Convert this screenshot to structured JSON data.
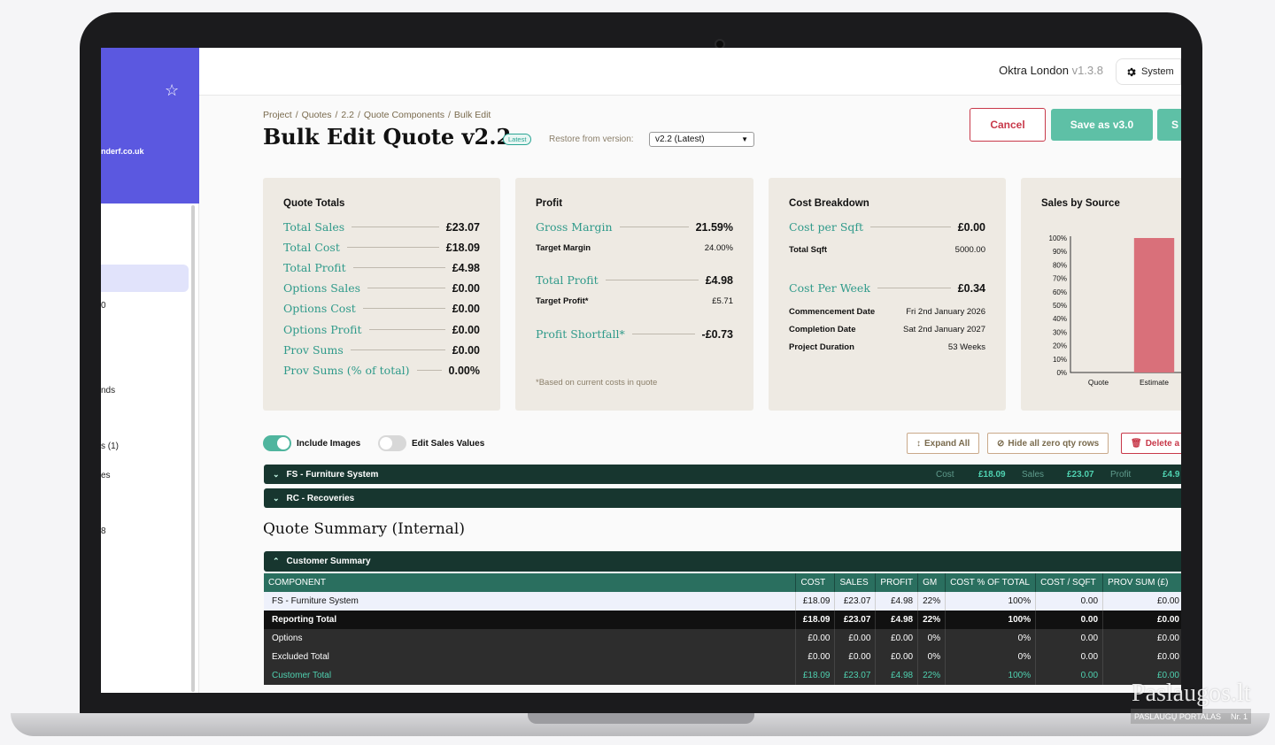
{
  "sidebar": {
    "email": "nderf.co.uk",
    "items": [
      "0",
      "nds",
      "s (1)",
      "es",
      "8"
    ]
  },
  "topbar": {
    "org": "Oktra London",
    "version": "v1.3.8",
    "system_label": "System"
  },
  "breadcrumb": [
    "Project",
    "/",
    "Quotes",
    "/",
    "2.2",
    "/",
    "Quote Components",
    "/",
    "Bulk Edit"
  ],
  "page": {
    "title": "Bulk Edit Quote v2.2",
    "badge": "Latest",
    "restore_label": "Restore from version:",
    "restore_value": "v2.2 (Latest)",
    "cancel": "Cancel",
    "save": "Save as v3.0",
    "save2": "S"
  },
  "quote_totals": {
    "title": "Quote Totals",
    "rows": [
      {
        "k": "Total Sales",
        "v": "£23.07"
      },
      {
        "k": "Total Cost",
        "v": "£18.09"
      },
      {
        "k": "Total Profit",
        "v": "£4.98"
      },
      {
        "k": "Options Sales",
        "v": "£0.00"
      },
      {
        "k": "Options Cost",
        "v": "£0.00"
      },
      {
        "k": "Options Profit",
        "v": "£0.00"
      },
      {
        "k": "Prov Sums",
        "v": "£0.00"
      },
      {
        "k": "Prov Sums (% of total)",
        "v": "0.00%"
      }
    ]
  },
  "profit": {
    "title": "Profit",
    "gross_margin_k": "Gross Margin",
    "gross_margin_v": "21.59%",
    "target_margin_k": "Target Margin",
    "target_margin_v": "24.00%",
    "total_profit_k": "Total Profit",
    "total_profit_v": "£4.98",
    "target_profit_k": "Target Profit*",
    "target_profit_v": "£5.71",
    "shortfall_k": "Profit Shortfall*",
    "shortfall_v": "-£0.73",
    "note": "*Based on current costs in quote"
  },
  "cost_breakdown": {
    "title": "Cost Breakdown",
    "cost_sqft_k": "Cost per Sqft",
    "cost_sqft_v": "£0.00",
    "total_sqft_k": "Total Sqft",
    "total_sqft_v": "5000.00",
    "cost_week_k": "Cost Per Week",
    "cost_week_v": "£0.34",
    "commence_k": "Commencement Date",
    "commence_v": "Fri 2nd January 2026",
    "complete_k": "Completion Date",
    "complete_v": "Sat 2nd January 2027",
    "duration_k": "Project Duration",
    "duration_v": "53 Weeks"
  },
  "chart_data": {
    "type": "bar",
    "title": "Sales by Source",
    "categories": [
      "Quote",
      "Estimate"
    ],
    "values": [
      0,
      100
    ],
    "ylim": [
      0,
      100
    ],
    "yticks": [
      "0%",
      "10%",
      "20%",
      "30%",
      "40%",
      "50%",
      "60%",
      "70%",
      "80%",
      "90%",
      "100%"
    ],
    "bar_color": "#d9707a"
  },
  "toolbar": {
    "include_images": "Include Images",
    "edit_sales": "Edit Sales Values",
    "expand_all": "Expand All",
    "hide_zero": "Hide all zero qty rows",
    "delete": "Delete a"
  },
  "groups": [
    {
      "label": "FS - Furniture System",
      "cost_label": "Cost",
      "cost": "£18.09",
      "sales_label": "Sales",
      "sales": "£23.07",
      "profit_label": "Profit",
      "profit": "£4.9"
    },
    {
      "label": "RC - Recoveries"
    }
  ],
  "summary": {
    "heading": "Quote Summary (Internal)",
    "group": "Customer Summary",
    "columns": [
      "COMPONENT",
      "COST",
      "SALES",
      "PROFIT",
      "GM",
      "COST % OF TOTAL",
      "COST / SQFT",
      "PROV SUM (£)"
    ],
    "rows": [
      [
        "FS - Furniture System",
        "£18.09",
        "£23.07",
        "£4.98",
        "22%",
        "100%",
        "0.00",
        "£0.00"
      ],
      [
        "Reporting Total",
        "£18.09",
        "£23.07",
        "£4.98",
        "22%",
        "100%",
        "0.00",
        "£0.00"
      ],
      [
        "Options",
        "£0.00",
        "£0.00",
        "£0.00",
        "0%",
        "0%",
        "0.00",
        "£0.00"
      ],
      [
        "Excluded Total",
        "£0.00",
        "£0.00",
        "£0.00",
        "0%",
        "0%",
        "0.00",
        "£0.00"
      ],
      [
        "Customer Total",
        "£18.09",
        "£23.07",
        "£4.98",
        "22%",
        "100%",
        "0.00",
        "£0.00"
      ]
    ]
  },
  "watermark": {
    "brand": "Paslaugos.lt",
    "sub": "PASLAUGŲ PORTALAS",
    "rank": "Nr. 1"
  }
}
